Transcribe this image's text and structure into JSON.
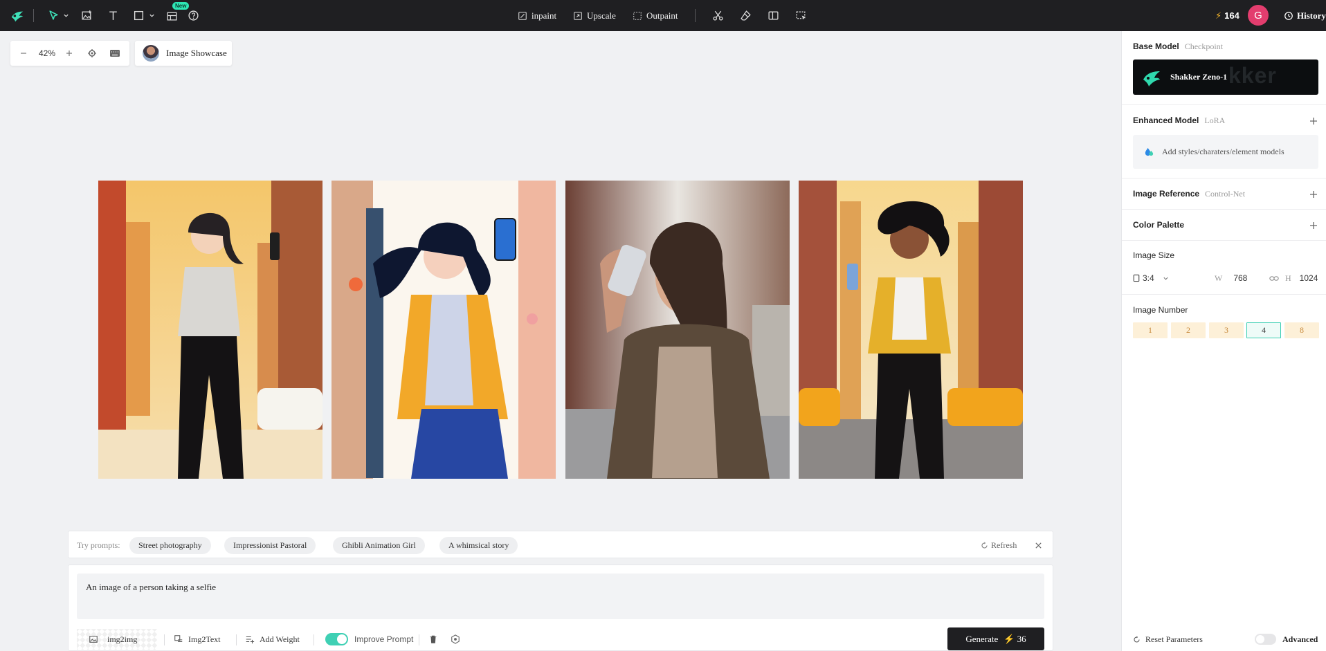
{
  "topbar": {
    "new_badge": "New",
    "actions": {
      "inpaint": "inpaint",
      "upscale": "Upscale",
      "outpaint": "Outpaint"
    },
    "credits": "164",
    "avatar_initial": "G",
    "history": "History"
  },
  "canvas": {
    "zoom": "42%",
    "showcase_label": "Image Showcase",
    "images": [
      {
        "icon": "generated-image-1"
      },
      {
        "icon": "generated-image-2"
      },
      {
        "icon": "generated-image-3"
      },
      {
        "icon": "generated-image-4"
      }
    ]
  },
  "prompts": {
    "try_label": "Try prompts:",
    "chips": [
      "Street photography",
      "Impressionist Pastoral",
      "Ghibli Animation Girl",
      "A whimsical story"
    ],
    "refresh": "Refresh"
  },
  "editor": {
    "prompt_text": "An image of a person taking a selfie",
    "img2img": "img2img",
    "img2text": "Img2Text",
    "add_weight": "Add Weight",
    "improve_prompt": "Improve Prompt",
    "improve_prompt_on": true,
    "generate_label": "Generate",
    "generate_cost": "36"
  },
  "panel": {
    "base_model": {
      "title": "Base Model",
      "sub": "Checkpoint",
      "model_name": "Shakker Zeno-1",
      "watermark": "kker"
    },
    "enhanced_model": {
      "title": "Enhanced Model",
      "sub": "LoRA",
      "placeholder": "Add styles/charaters/element models"
    },
    "image_reference": {
      "title": "Image Reference",
      "sub": "Control-Net"
    },
    "color_palette": {
      "title": "Color Palette"
    },
    "image_size": {
      "title": "Image Size",
      "ratio": "3:4",
      "w_label": "W",
      "width": "768",
      "h_label": "H",
      "height": "1024"
    },
    "image_number": {
      "title": "Image Number",
      "options": [
        "1",
        "2",
        "3",
        "4",
        "8"
      ],
      "selected": "4"
    },
    "reset": "Reset Parameters",
    "advanced": "Advanced"
  },
  "colors": {
    "accent": "#36cdb0",
    "brand_dark": "#1f1f22",
    "credit_bolt": "#f5b52a",
    "avatar": "#e33d6e"
  }
}
